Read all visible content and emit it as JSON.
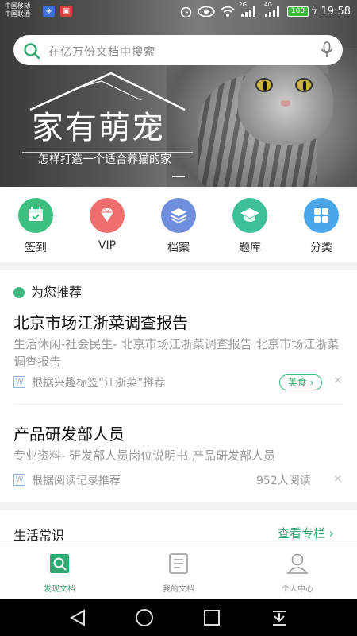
{
  "status_bar": {
    "carrier_1": "中国移动",
    "carrier_2": "中国联通",
    "battery": "100",
    "time": "19:58",
    "signal_1": "2G",
    "signal_2": "4G"
  },
  "search": {
    "placeholder": "在亿万份文档中搜索"
  },
  "banner": {
    "title": "家有萌宠",
    "subtitle": "怎样打造一个适合养猫的家"
  },
  "quick_links": [
    {
      "label": "签到",
      "color": "#3dbf7f",
      "icon": "calendar-icon"
    },
    {
      "label": "VIP",
      "color": "#ef6f6f",
      "icon": "diamond-icon"
    },
    {
      "label": "档案",
      "color": "#6f8fde",
      "icon": "layers-icon"
    },
    {
      "label": "题库",
      "color": "#3dbf9a",
      "icon": "graduation-cap-icon"
    },
    {
      "label": "分类",
      "color": "#4aa6e8",
      "icon": "grid-icon"
    }
  ],
  "recommend": {
    "heading": "为您推荐",
    "articles": [
      {
        "title": "北京市场江浙菜调查报告",
        "desc": "生活休闲-社会民生- 北京市场江浙菜调查报告 北京市场江浙菜调查报告",
        "reason": "根据兴趣标签“江浙菜”推荐",
        "tag": "美食 ›"
      },
      {
        "title": "产品研发部人员",
        "desc": "专业资料- 研发部人员岗位说明书 产品研发部人员",
        "reason": "根据阅读记录推荐",
        "reads": "952人阅读"
      }
    ]
  },
  "life": {
    "title": "生活常识",
    "more": "查看专栏 ›"
  },
  "nav": {
    "items": [
      {
        "label": "发现文档",
        "active": true
      },
      {
        "label": "我的文档",
        "active": false
      },
      {
        "label": "个人中心",
        "active": false
      }
    ]
  },
  "colors": {
    "accent": "#2ea86e",
    "background": "#f2f2f2"
  }
}
